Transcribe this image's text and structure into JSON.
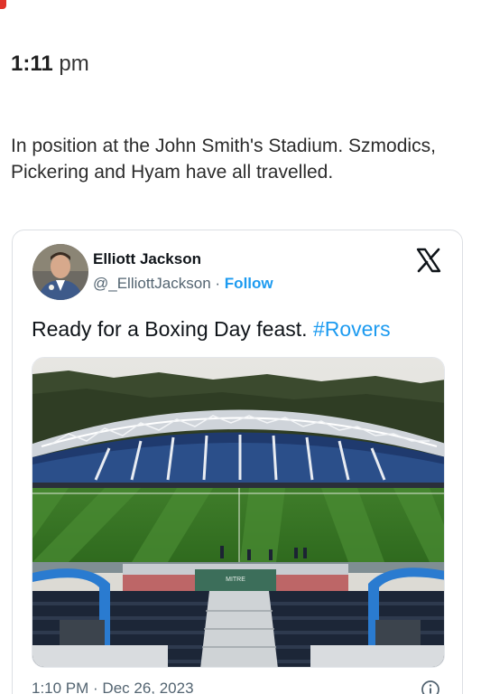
{
  "header": {
    "time_main": "1:11",
    "time_suffix": "pm"
  },
  "post": {
    "text": "In position at the John Smith's Stadium. Szmodics, Pickering and Hyam have all travelled."
  },
  "embed": {
    "author_name": "Elliott Jackson",
    "handle": "@_ElliottJackson",
    "separator": "·",
    "follow_label": "Follow",
    "tweet_text": "Ready for a Boxing Day feast. ",
    "hashtag": "#Rovers",
    "timestamp": "1:10 PM · Dec 26, 2023",
    "photo_banner_text": "MITRE",
    "icons": {
      "platform_logo": "x-logo-icon",
      "info": "info-icon"
    }
  },
  "colors": {
    "link_blue": "#1d9bf0",
    "accent_red": "#e0332a",
    "secondary_text": "#536471"
  }
}
